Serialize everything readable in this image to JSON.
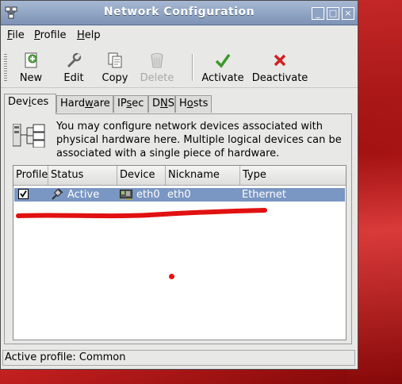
{
  "window": {
    "title": "Network Configuration",
    "controls": {
      "minimize": "_",
      "maximize": "□",
      "close": "×"
    }
  },
  "menu": {
    "file": {
      "label": "File",
      "ul": "F",
      "rest": "ile"
    },
    "profile": {
      "label": "Profile",
      "ul": "P",
      "rest": "rofile"
    },
    "help": {
      "label": "Help",
      "ul": "H",
      "rest": "elp"
    }
  },
  "toolbar": {
    "new_label": "New",
    "edit_label": "Edit",
    "copy_label": "Copy",
    "delete_label": "Delete",
    "activate_label": "Activate",
    "deactivate_label": "Deactivate"
  },
  "tabs": {
    "devices": "Devices",
    "hardware": "Hardware",
    "ipsec": "IPsec",
    "dns": "DNS",
    "hosts": "Hosts",
    "active": "Devices"
  },
  "devices_panel": {
    "info_text": "You may configure network devices associated with physical hardware here.  Multiple logical devices can be associated with a single piece of hardware.",
    "columns": {
      "profile": "Profile",
      "status": "Status",
      "device": "Device",
      "nickname": "Nickname",
      "type": "Type"
    },
    "rows": [
      {
        "profile_checked": true,
        "status": "Active",
        "device": "eth0",
        "nickname": "eth0",
        "type": "Ethernet"
      }
    ]
  },
  "statusbar": {
    "text": "Active profile: Common"
  },
  "colors": {
    "selection": "#7a96c2",
    "titlebar": "#8ea2c2",
    "annotation_red": "#e11111",
    "desktop_red": "#a51313"
  }
}
